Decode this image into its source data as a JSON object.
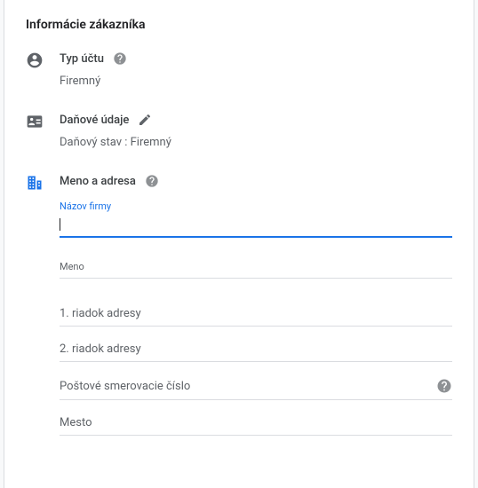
{
  "title": "Informácie zákazníka",
  "account": {
    "label": "Typ účtu",
    "value": "Firemný"
  },
  "tax": {
    "label": "Daňové údaje",
    "status_label": "Daňový stav",
    "status_value": "Firemný"
  },
  "address": {
    "label": "Meno a adresa",
    "company_name_label": "Názov firmy",
    "company_name_value": "",
    "fields": {
      "name": "Meno",
      "line1": "1. riadok adresy",
      "line2": "2. riadok adresy",
      "postal": "Poštové smerovacie číslo",
      "city": "Mesto"
    }
  }
}
